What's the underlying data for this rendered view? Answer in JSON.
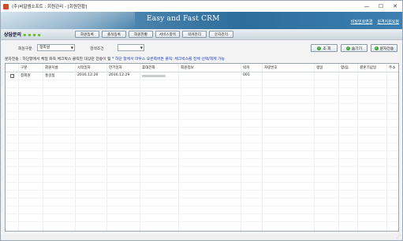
{
  "window": {
    "title": "(주)비알엠소프트 : 회원관리 - [회원현황]",
    "minimize": "—",
    "maximize": "☐",
    "close": "✕"
  },
  "banner": {
    "brand": "Easy and Fast CRM",
    "links": [
      "비밀번호변경",
      "원격지원요청"
    ]
  },
  "menu": {
    "consult_prefix": "상담문의",
    "consult_highlight": "▪ ▪ ▪ ▪",
    "buttons": [
      "회원등록",
      "출석등록",
      "회원현황",
      "서비스항목",
      "락커관리",
      "문자관리"
    ]
  },
  "filters": {
    "member_type_label": "회원구분",
    "member_type_value": "정회원",
    "search_label": "검색조건",
    "search_value": "",
    "actions": {
      "search": "조 회",
      "hide": "숨기기",
      "sms": "문자전송"
    }
  },
  "notice": {
    "text": "문자전송 : 하단항에서 체일 좌측 체크박스 클릭한 대상만 전송이 됨",
    "hint": "* 하단 항에서 마우스 오른쪽버튼 클릭: 체크박스를 전체 선택/해제 가능"
  },
  "table": {
    "headers": [
      "구분",
      "회원이름",
      "시작일자",
      "만기일자",
      "휴대전화",
      "회원정보",
      "락커",
      "차량번호",
      "생일",
      "양/음",
      "결혼기념일",
      "주소"
    ],
    "rows": [
      {
        "category": "정회원",
        "name": "홍길동",
        "start": "2016.12.26",
        "end": "2016.12.29",
        "phone": "",
        "info": "",
        "locker": "001",
        "car": "",
        "birthday": "",
        "lunar": "",
        "anniversary": "",
        "address": ""
      }
    ]
  },
  "colors": {
    "banner_dark": "#2d6d9c",
    "accent_green": "#3fa534",
    "notice_blue": "#1a3fc6"
  }
}
